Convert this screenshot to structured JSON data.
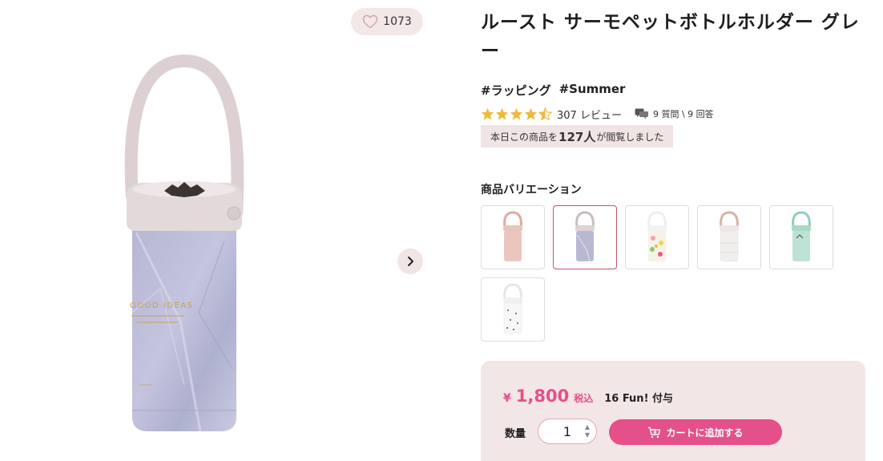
{
  "gallery": {
    "favorite_count": "1073",
    "product_print_line1": "GOOD IDEAS"
  },
  "product": {
    "title": "ルースト サーモペットボトルホルダー グレー",
    "tags": [
      "#ラッピング",
      "#Summer"
    ],
    "rating": 4.5,
    "review_count": "307",
    "review_label": "レビュー",
    "qa_text": "9 質問 \\ 9 回答",
    "viewed_prefix": "本日この商品を",
    "viewed_count": "127人",
    "viewed_suffix": "が閲覧しました"
  },
  "variations": {
    "label": "商品バリエーション",
    "items": [
      {
        "name": "pink",
        "body_color": "#e9c4bd",
        "strap_color": "#e3a9a3"
      },
      {
        "name": "gray-marble",
        "body_color": "#b9b8d2",
        "strap_color": "#c9bcc0",
        "selected": true
      },
      {
        "name": "floral",
        "body_color": "#f6f2e6",
        "strap_color": "#ffffff"
      },
      {
        "name": "white-stripe",
        "body_color": "#f1eeee",
        "strap_color": "#d7b3a8"
      },
      {
        "name": "mint",
        "body_color": "#bde2d3",
        "strap_color": "#8fcfb8"
      },
      {
        "name": "white-dots",
        "body_color": "#f7f7f7",
        "strap_color": "#ffffff"
      }
    ]
  },
  "purchase": {
    "currency": "¥",
    "price": "1,800",
    "tax_label": "税込",
    "fun_text": "16 Fun! 付与",
    "quantity_label": "数量",
    "quantity_value": "1",
    "add_to_cart_label": "カートに追加する"
  },
  "colors": {
    "accent": "#e4508a",
    "panel_bg": "#f3e6e6",
    "selected_border": "#c2566c",
    "star": "#f0b93b"
  },
  "icons": {
    "favorite": "heart-icon",
    "next": "chevron-right-icon",
    "qa": "chat-bubbles-icon",
    "cart": "cart-plus-icon"
  }
}
